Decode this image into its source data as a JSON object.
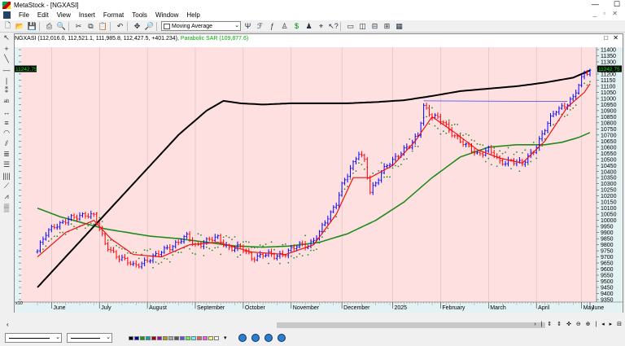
{
  "window": {
    "title": "MetaStock - [NGXASI]",
    "minimize": "—",
    "maximize": "☐"
  },
  "menu": {
    "items": [
      "File",
      "Edit",
      "View",
      "Insert",
      "Format",
      "Tools",
      "Window",
      "Help"
    ],
    "mdi_controls": "_ ▫ ✕"
  },
  "toolbar": {
    "indicator_select": "Moving Average"
  },
  "chart_window": {
    "symbol": "NGXASI",
    "caption": "NGXASI (112,016.0, 112,521.1, 111,985.8, 112,427.5, +401.234),",
    "sar_label": "Parabolic SAR (109,877.6)",
    "controls": "□ ✕",
    "price_badge": "11242.75",
    "scale_marker": "x10"
  },
  "colors": {
    "plot_bg": "#ffe0e0",
    "axis_bg": "#e4f2f4",
    "up_bar": "#0000ff",
    "down_bar": "#ff0000",
    "long_ma": "#000000",
    "mid_ma": "#1e8c1e",
    "short_ma": "#ee1111",
    "sar": "#2a8a2a",
    "trend_line": "#3344ff"
  },
  "chart_data": {
    "type": "ohlc",
    "months": [
      "June",
      "July",
      "August",
      "September",
      "October",
      "November",
      "December",
      "2025",
      "February",
      "March",
      "April",
      "May",
      "June"
    ],
    "y_ticks": [
      9350,
      9400,
      9450,
      9500,
      9550,
      9600,
      9650,
      9700,
      9750,
      9800,
      9850,
      9900,
      9950,
      10000,
      10050,
      10100,
      10150,
      10200,
      10250,
      10300,
      10350,
      10400,
      10450,
      10500,
      10550,
      10600,
      10650,
      10700,
      10750,
      10800,
      10850,
      10900,
      10950,
      11000,
      11050,
      11100,
      11150,
      11200,
      11250,
      11300,
      11350,
      11400
    ],
    "ylim": [
      9330,
      11420
    ],
    "close_knots": [
      [
        0,
        9750
      ],
      [
        3,
        9880
      ],
      [
        6,
        9960
      ],
      [
        9,
        9990
      ],
      [
        14,
        10020
      ],
      [
        17,
        10060
      ],
      [
        20,
        10040
      ],
      [
        24,
        9800
      ],
      [
        29,
        9700
      ],
      [
        34,
        9620
      ],
      [
        38,
        9670
      ],
      [
        42,
        9700
      ],
      [
        46,
        9780
      ],
      [
        50,
        9820
      ],
      [
        53,
        9860
      ],
      [
        56,
        9800
      ],
      [
        60,
        9830
      ],
      [
        64,
        9850
      ],
      [
        68,
        9780
      ],
      [
        72,
        9770
      ],
      [
        76,
        9700
      ],
      [
        80,
        9720
      ],
      [
        84,
        9700
      ],
      [
        88,
        9740
      ],
      [
        92,
        9780
      ],
      [
        96,
        9800
      ],
      [
        100,
        9900
      ],
      [
        104,
        10050
      ],
      [
        106,
        10150
      ],
      [
        108,
        10300
      ],
      [
        112,
        10450
      ],
      [
        114,
        10550
      ],
      [
        116,
        10500
      ],
      [
        118,
        10250
      ],
      [
        120,
        10300
      ],
      [
        124,
        10450
      ],
      [
        128,
        10550
      ],
      [
        132,
        10600
      ],
      [
        135,
        10700
      ],
      [
        137,
        10950
      ],
      [
        140,
        10850
      ],
      [
        144,
        10800
      ],
      [
        148,
        10700
      ],
      [
        152,
        10600
      ],
      [
        156,
        10550
      ],
      [
        160,
        10580
      ],
      [
        164,
        10470
      ],
      [
        168,
        10500
      ],
      [
        172,
        10450
      ],
      [
        176,
        10580
      ],
      [
        180,
        10750
      ],
      [
        184,
        10900
      ],
      [
        188,
        10970
      ],
      [
        190,
        11000
      ],
      [
        192,
        11100
      ],
      [
        194,
        11200
      ],
      [
        196,
        11240
      ]
    ],
    "long_ma_knots": [
      [
        0,
        9450
      ],
      [
        10,
        9700
      ],
      [
        20,
        9950
      ],
      [
        30,
        10200
      ],
      [
        40,
        10450
      ],
      [
        50,
        10700
      ],
      [
        60,
        10900
      ],
      [
        66,
        10980
      ],
      [
        72,
        10960
      ],
      [
        80,
        10950
      ],
      [
        90,
        10960
      ],
      [
        100,
        10960
      ],
      [
        110,
        10960
      ],
      [
        120,
        10970
      ],
      [
        130,
        10985
      ],
      [
        140,
        11020
      ],
      [
        150,
        11060
      ],
      [
        160,
        11080
      ],
      [
        170,
        11100
      ],
      [
        180,
        11130
      ],
      [
        190,
        11170
      ],
      [
        196,
        11230
      ]
    ],
    "mid_ma_knots": [
      [
        0,
        10100
      ],
      [
        8,
        10030
      ],
      [
        16,
        9980
      ],
      [
        24,
        9930
      ],
      [
        32,
        9900
      ],
      [
        40,
        9870
      ],
      [
        50,
        9850
      ],
      [
        60,
        9820
      ],
      [
        70,
        9790
      ],
      [
        80,
        9780
      ],
      [
        90,
        9790
      ],
      [
        100,
        9820
      ],
      [
        110,
        9890
      ],
      [
        120,
        10000
      ],
      [
        130,
        10150
      ],
      [
        140,
        10350
      ],
      [
        150,
        10520
      ],
      [
        160,
        10600
      ],
      [
        170,
        10620
      ],
      [
        180,
        10620
      ],
      [
        186,
        10640
      ],
      [
        192,
        10680
      ],
      [
        196,
        10720
      ]
    ],
    "short_ma_knots": [
      [
        0,
        9700
      ],
      [
        10,
        9900
      ],
      [
        20,
        10000
      ],
      [
        26,
        9850
      ],
      [
        34,
        9720
      ],
      [
        44,
        9700
      ],
      [
        54,
        9800
      ],
      [
        64,
        9820
      ],
      [
        76,
        9740
      ],
      [
        88,
        9720
      ],
      [
        98,
        9800
      ],
      [
        106,
        10050
      ],
      [
        112,
        10350
      ],
      [
        118,
        10350
      ],
      [
        126,
        10450
      ],
      [
        134,
        10650
      ],
      [
        140,
        10850
      ],
      [
        148,
        10720
      ],
      [
        156,
        10580
      ],
      [
        164,
        10510
      ],
      [
        172,
        10470
      ],
      [
        180,
        10650
      ],
      [
        188,
        10930
      ],
      [
        194,
        11050
      ],
      [
        196,
        11120
      ]
    ],
    "trend_line": [
      [
        137,
        10980
      ],
      [
        188,
        10975
      ]
    ]
  },
  "statusbar": {
    "palette": [
      "#000000",
      "#0000aa",
      "#00aa00",
      "#00aaaa",
      "#aa0000",
      "#aa00aa",
      "#aaaa00",
      "#aaaaaa",
      "#555555",
      "#5555ff",
      "#55ff55",
      "#55ffff",
      "#ff5555",
      "#ff55ff",
      "#ffff55",
      "#ffffff"
    ]
  }
}
